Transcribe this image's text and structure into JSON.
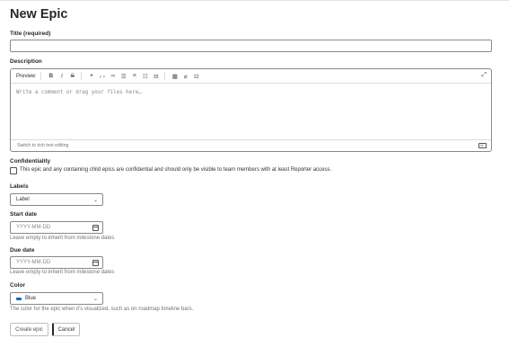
{
  "page": {
    "title": "New Epic"
  },
  "title_field": {
    "label": "Title (required)",
    "value": ""
  },
  "description": {
    "label": "Description",
    "tab_preview": "Preview",
    "toolbar_icons": [
      "bold-icon",
      "italic-icon",
      "strikethrough-icon",
      "quote-icon",
      "code-icon",
      "link-icon",
      "bullet-list-icon",
      "numbered-list-icon",
      "task-list-icon",
      "collapsible-icon",
      "table-icon",
      "attach-icon",
      "quick-action-icon",
      "fullscreen-icon"
    ],
    "placeholder": "Write a comment or drag your files here…",
    "switch_text": "Switch to rich text editing"
  },
  "confidentiality": {
    "label": "Confidentiality",
    "checkbox_text": "This epic and any containing child epics are confidential and should only be visible to team members with at least Reporter access.",
    "checked": false
  },
  "labels": {
    "label": "Labels",
    "value": "Label"
  },
  "start_date": {
    "label": "Start date",
    "placeholder": "YYYY-MM-DD",
    "help": "Leave empty to inherit from milestone dates"
  },
  "due_date": {
    "label": "Due date",
    "placeholder": "YYYY-MM-DD",
    "help": "Leave empty to inherit from milestone dates"
  },
  "color": {
    "label": "Color",
    "value": "Blue",
    "swatch": "#1068bf",
    "help": "The color for the epic when it's visualized, such as on roadmap timeline bars."
  },
  "actions": {
    "create": "Create epic",
    "cancel": "Cancel"
  }
}
